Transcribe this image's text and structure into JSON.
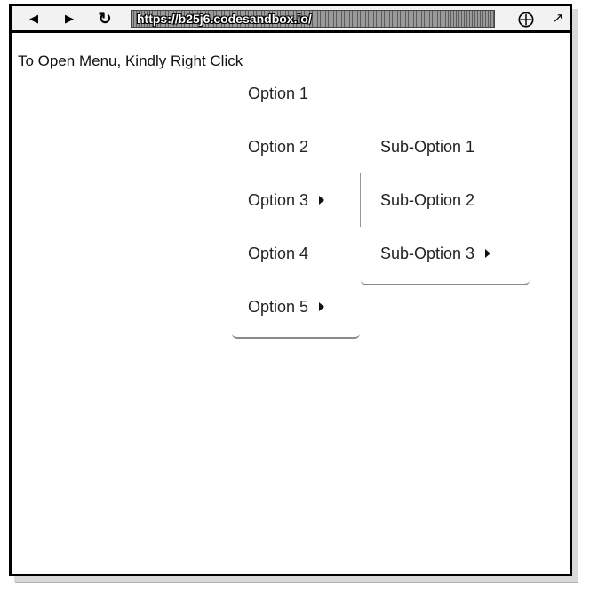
{
  "browser": {
    "url": "https://b25j6.codesandbox.io/",
    "back_icon": "back-arrow-icon",
    "forward_icon": "forward-arrow-icon",
    "reload_icon": "reload-icon",
    "extension_icon": "extension-icon",
    "open_external_icon": "open-external-icon"
  },
  "page": {
    "instruction": "To Open Menu, Kindly Right Click"
  },
  "menu": {
    "items": [
      {
        "label": "Option 1",
        "has_submenu": false
      },
      {
        "label": "Option 2",
        "has_submenu": false
      },
      {
        "label": "Option 3",
        "has_submenu": true
      },
      {
        "label": "Option 4",
        "has_submenu": false
      },
      {
        "label": "Option 5",
        "has_submenu": true
      }
    ]
  },
  "submenu": {
    "parent": "Option 3",
    "items": [
      {
        "label": "Sub-Option 1",
        "has_submenu": false
      },
      {
        "label": "Sub-Option 2",
        "has_submenu": false
      },
      {
        "label": "Sub-Option 3",
        "has_submenu": true
      }
    ]
  }
}
